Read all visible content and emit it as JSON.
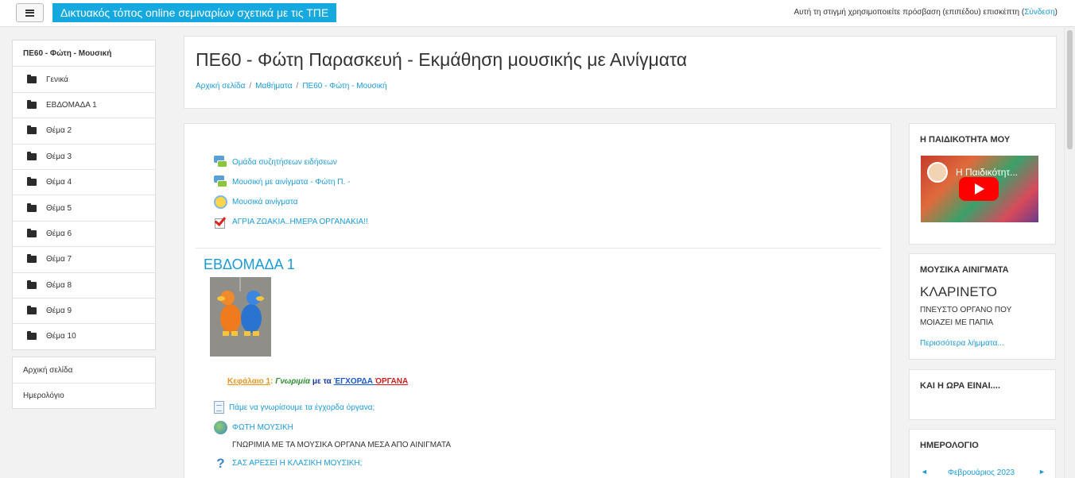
{
  "navbar": {
    "site_title": "Δικτυακός τόπος online σεμιναρίων σχετικά με τις ΤΠΕ",
    "login_text": "Αυτή τη στιγμή χρησιμοποιείτε πρόσβαση (επιπέδου) επισκέπτη (",
    "login_link": "Σύνδεση",
    "login_close": ")"
  },
  "leftnav": {
    "header": "ΠΕ60 - Φώτη - Μουσική",
    "items": [
      {
        "label": "Γενικά",
        "icon": "folder-icon"
      },
      {
        "label": "ΕΒΔΟΜΑΔΑ 1",
        "icon": "folder-icon"
      },
      {
        "label": "Θέμα 2",
        "icon": "folder-icon"
      },
      {
        "label": "Θέμα 3",
        "icon": "folder-icon"
      },
      {
        "label": "Θέμα 4",
        "icon": "folder-icon"
      },
      {
        "label": "Θέμα 5",
        "icon": "folder-icon"
      },
      {
        "label": "Θέμα 6",
        "icon": "folder-icon"
      },
      {
        "label": "Θέμα 7",
        "icon": "folder-icon"
      },
      {
        "label": "Θέμα 8",
        "icon": "folder-icon"
      },
      {
        "label": "Θέμα 9",
        "icon": "folder-icon"
      },
      {
        "label": "Θέμα 10",
        "icon": "folder-icon"
      }
    ],
    "extra": [
      "Αρχική σελίδα",
      "Ημερολόγιο"
    ]
  },
  "header": {
    "title": "ΠΕ60 - Φώτη Παρασκευή - Εκμάθηση μουσικής με Αινίγματα",
    "breadcrumb": [
      "Αρχική σελίδα",
      "Μαθήματα",
      "ΠΕ60 - Φώτη - Μουσική"
    ],
    "separator": "/"
  },
  "general_activities": [
    {
      "label": "Ομάδα συζητήσεων ειδήσεων",
      "icon": "forum-icon"
    },
    {
      "label": "Μουσική με αινίγματα - Φώτη Π. -",
      "icon": "forum-icon"
    },
    {
      "label": "Μουσικά αινίγματα",
      "icon": "chat-icon"
    },
    {
      "label": "ΑΓΡΙΑ ΖΩΑΚΙΑ..ΗΜΕΡΑ ΟΡΓΑΝΑΚΙΑ!!",
      "icon": "choice-icon"
    }
  ],
  "section1": {
    "title": "ΕΒΔΟΜΑΔΑ 1",
    "chapter": {
      "part1": "Κεφάλαιο 1",
      "colon": ":",
      "part2": "Γνωριμία",
      "part3": " με τα ",
      "part4": "ΈΓΧΟΡΔΑ ",
      "part5": "ΌΡΓΑΝΑ"
    },
    "activities": [
      {
        "label": "Πάμε να γνωρίσουμε τα έγχορδα όργανα;",
        "icon": "page-icon"
      },
      {
        "label": "ΦΩΤΗ ΜΟΥΣΙΚΗ",
        "icon": "url-icon"
      }
    ],
    "text_line": "ΓΝΩΡΙΜΙΑ ΜΕ ΤΑ ΜΟΥΣΙΚΑ ΟΡΓΑΝΑ ΜΕΣΑ ΑΠΟ ΑΙΝΙΓΜΑΤΑ",
    "quiz": {
      "label": "ΣΑΣ ΑΡΕΣΕΙ Η ΚΛΑΣΙΚΗ ΜΟΥΣΙΚΗ;",
      "icon": "question-icon"
    }
  },
  "blocks": {
    "childhood": {
      "title": "Η ΠΑΙΔΙΚΟΤΗΤΑ ΜΟΥ",
      "video_title": "Η Παιδικότητ..."
    },
    "riddles": {
      "title": "ΜΟΥΣΙΚΑ ΑΙΝΙΓΜΑΤΑ",
      "word": "ΚΛΑΡΙΝΕΤΟ",
      "description": "ΠΝΕΥΣΤΟ ΟΡΓΑΝΟ ΠΟΥ ΜΟΙΑΖΕΙ ΜΕ ΠΑΠΙΑ",
      "more": "Περισσότερα λήμματα..."
    },
    "time": {
      "title": "ΚΑΙ Η ΩΡΑ ΕΙΝΑΙ...."
    },
    "calendar": {
      "title": "ΗΜΕΡΟΛΟΓΙΟ",
      "prev": "◄",
      "month": "Φεβρουάριος 2023",
      "next": "►"
    }
  }
}
